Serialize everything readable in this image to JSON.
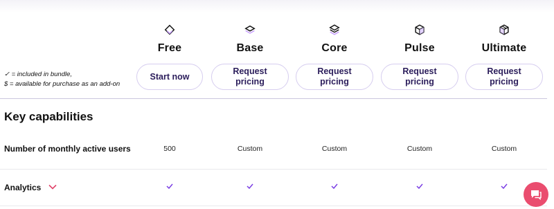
{
  "plans": [
    {
      "name": "Free",
      "icon": "diamond-icon",
      "button": "Start now"
    },
    {
      "name": "Base",
      "icon": "layers-icon",
      "button": "Request pricing"
    },
    {
      "name": "Core",
      "icon": "layers-stack-icon",
      "button": "Request pricing"
    },
    {
      "name": "Pulse",
      "icon": "cube-icon",
      "button": "Request pricing"
    },
    {
      "name": "Ultimate",
      "icon": "cube-box-icon",
      "button": "Request pricing"
    }
  ],
  "legend": {
    "line1": "✓ = included in bundle,",
    "line2": "$ = available for purchase as an add-on"
  },
  "section": {
    "title": "Key capabilities"
  },
  "rows": [
    {
      "label": "Number of monthly active users",
      "values": [
        "500",
        "Custom",
        "Custom",
        "Custom",
        "Custom"
      ]
    },
    {
      "label": "Analytics",
      "values": [
        "✓",
        "✓",
        "✓",
        "✓",
        "✓"
      ]
    }
  ],
  "colors": {
    "accent_purple": "#7b3fe4",
    "chevron_pink": "#e0446a",
    "chat_pink": "#ea4d6f",
    "button_border": "#d6cdef"
  }
}
